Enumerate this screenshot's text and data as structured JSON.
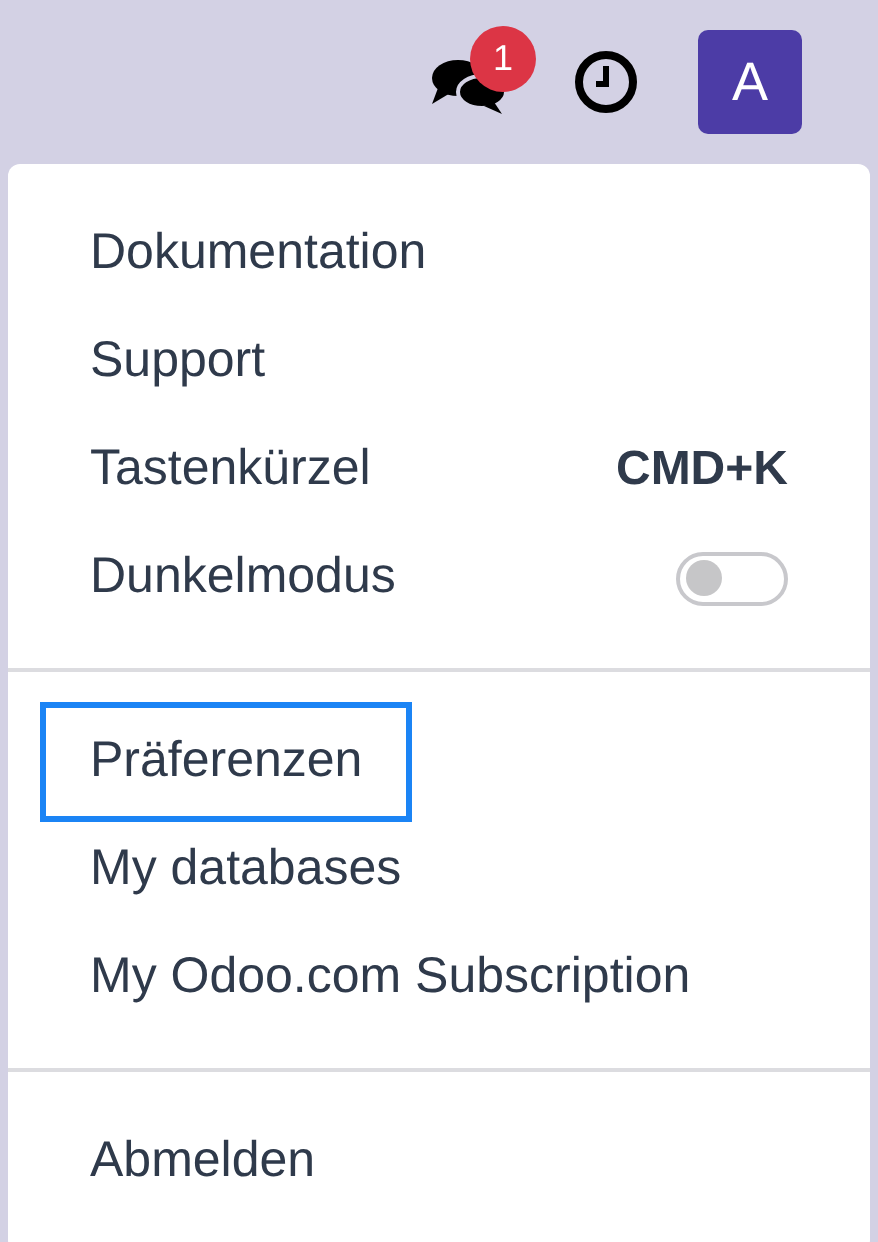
{
  "topbar": {
    "messages_badge": "1",
    "avatar": {
      "initial": "A",
      "color": "#4c3ca6"
    }
  },
  "menu": {
    "sections": [
      {
        "items": [
          {
            "kind": "link",
            "label": "Dokumentation",
            "focused": false
          },
          {
            "kind": "link",
            "label": "Support",
            "focused": false
          },
          {
            "kind": "shortcut",
            "label": "Tastenkürzel",
            "shortcut": "CMD+K",
            "focused": false
          },
          {
            "kind": "toggle",
            "label": "Dunkelmodus",
            "on": false,
            "focused": false
          }
        ]
      },
      {
        "items": [
          {
            "kind": "link",
            "label": "Präferenzen",
            "focused": true
          },
          {
            "kind": "link",
            "label": "My databases",
            "focused": false
          },
          {
            "kind": "link",
            "label": "My Odoo.com Subscription",
            "focused": false
          }
        ]
      },
      {
        "items": [
          {
            "kind": "link",
            "label": "Abmelden",
            "focused": false
          }
        ]
      }
    ]
  }
}
